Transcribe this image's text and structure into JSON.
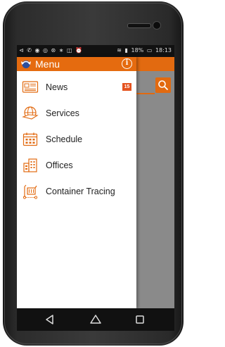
{
  "status_bar": {
    "left_icons": "⊲ ✆ ◉ ◎ ⊛ ∗ ◫ ⏰",
    "battery": "18%",
    "time": "18:13"
  },
  "drawer": {
    "title": "Menu",
    "items": [
      {
        "label": "News",
        "icon": "news-icon",
        "badge": "15"
      },
      {
        "label": "Services",
        "icon": "services-icon"
      },
      {
        "label": "Schedule",
        "icon": "schedule-icon"
      },
      {
        "label": "Offices",
        "icon": "offices-icon"
      },
      {
        "label": "Container Tracing",
        "icon": "container-tracing-icon"
      }
    ]
  },
  "colors": {
    "accent": "#e56b0f",
    "badge": "#e5531f",
    "icon": "#e26a10"
  },
  "nav": {
    "buttons": [
      "back-icon",
      "home-icon",
      "recents-icon"
    ]
  }
}
